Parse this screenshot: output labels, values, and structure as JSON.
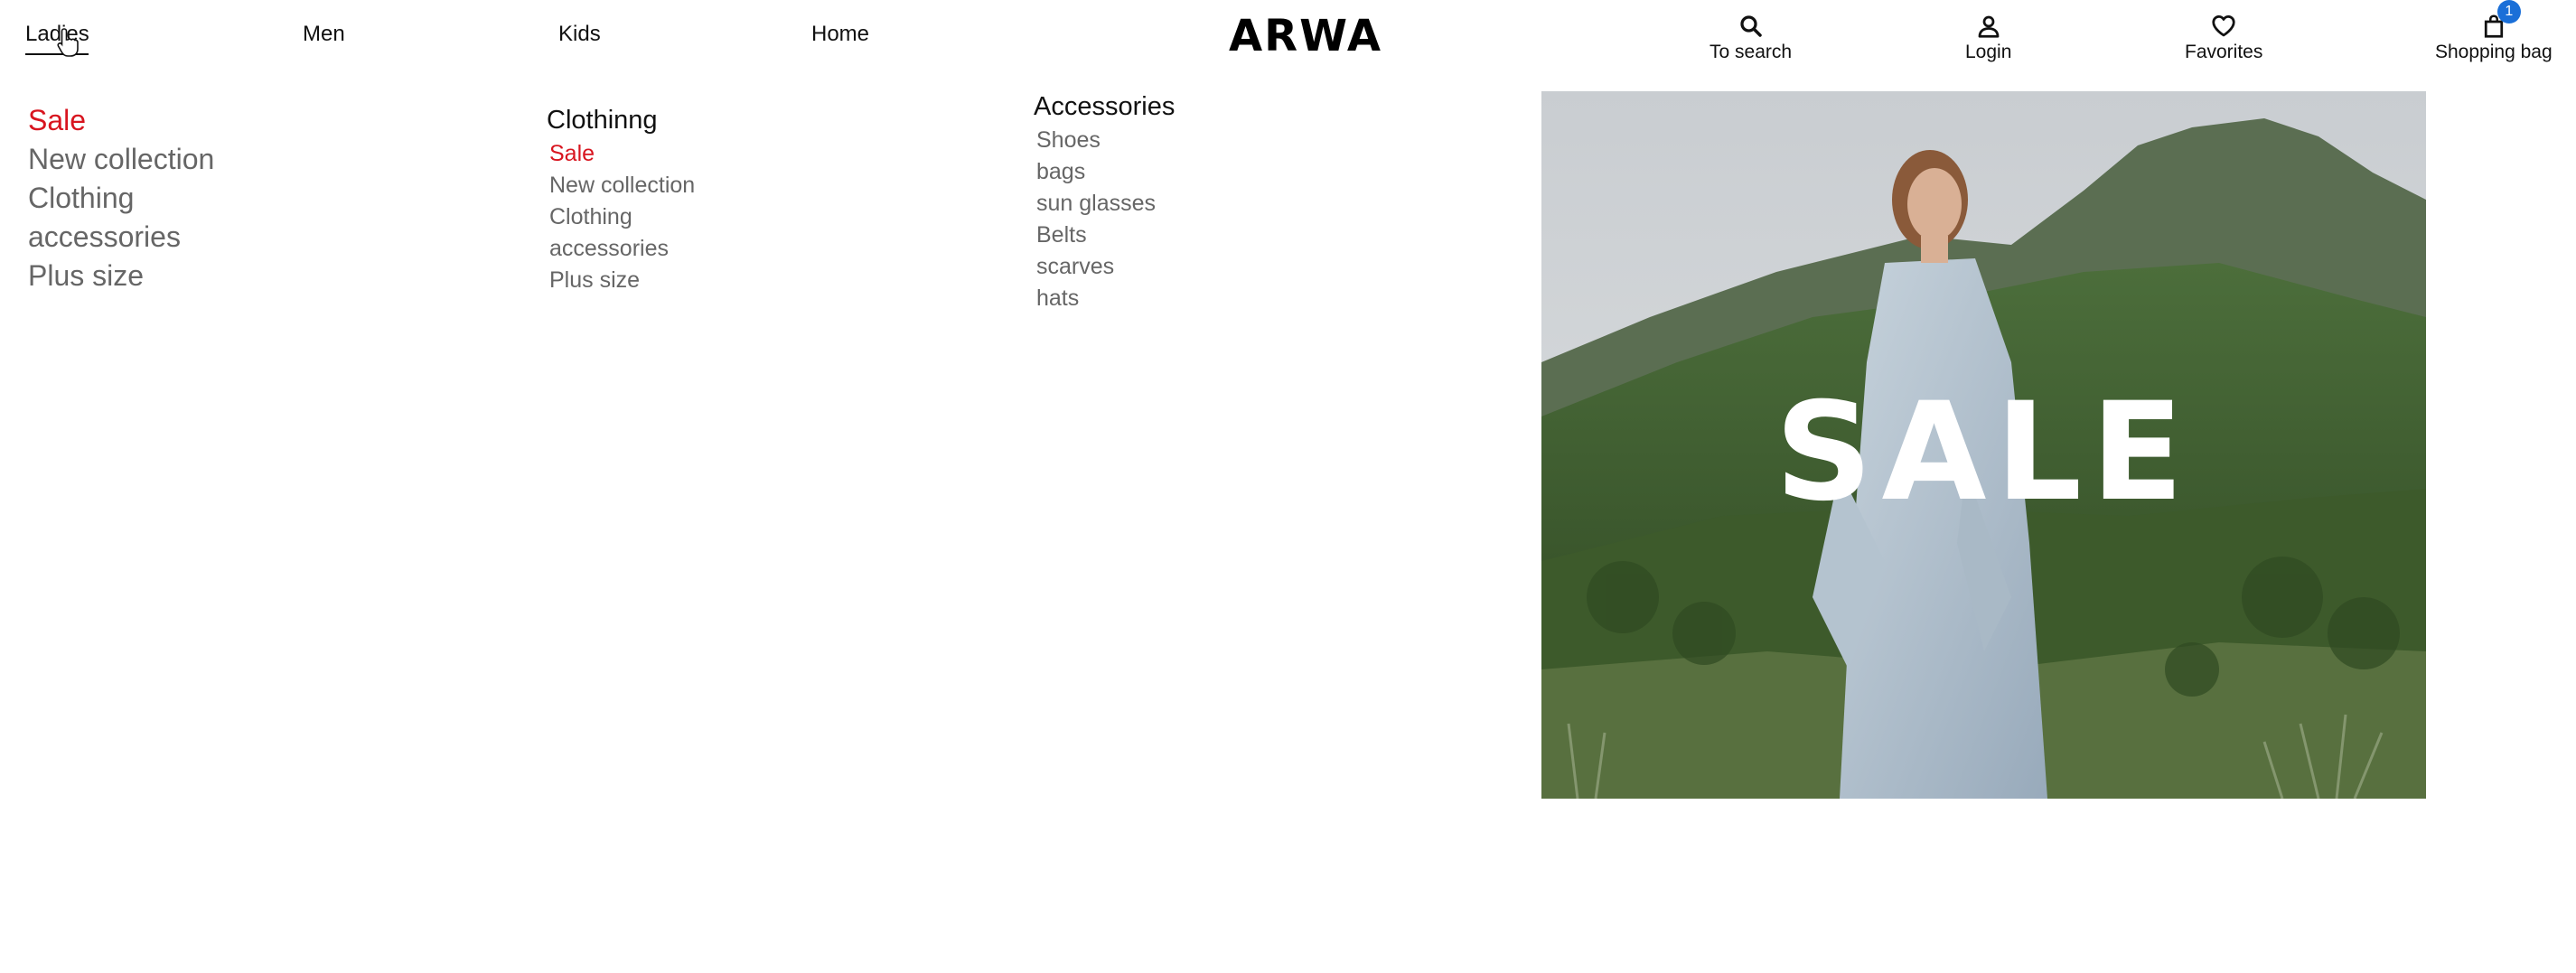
{
  "header": {
    "nav": [
      {
        "label": "Ladies",
        "active": true
      },
      {
        "label": "Men"
      },
      {
        "label": "Kids"
      },
      {
        "label": "Home"
      }
    ],
    "logo": "ARWA",
    "utilities": {
      "search": {
        "label": "To search",
        "icon": "search-icon"
      },
      "login": {
        "label": "Login",
        "icon": "user-icon"
      },
      "favorites": {
        "label": "Favorites",
        "icon": "heart-icon"
      },
      "bag": {
        "label": "Shopping bag",
        "icon": "shopping-bag-icon",
        "count": "1"
      }
    }
  },
  "menu": {
    "main": [
      "Sale",
      "New collection",
      "Clothing",
      "accessories",
      "Plus size"
    ],
    "clothing": {
      "heading": "Clothinng",
      "items": [
        "Sale",
        "New collection",
        "Clothing",
        "accessories",
        "Plus size"
      ]
    },
    "accessories": {
      "heading": "Accessories",
      "items": [
        "Shoes",
        "bags",
        "sun glasses",
        "Belts",
        "scarves",
        "hats"
      ]
    }
  },
  "hero": {
    "text": "SALE"
  },
  "colors": {
    "sale_red": "#d8151f",
    "badge_blue": "#1a6fd8",
    "muted_text": "#666666"
  }
}
